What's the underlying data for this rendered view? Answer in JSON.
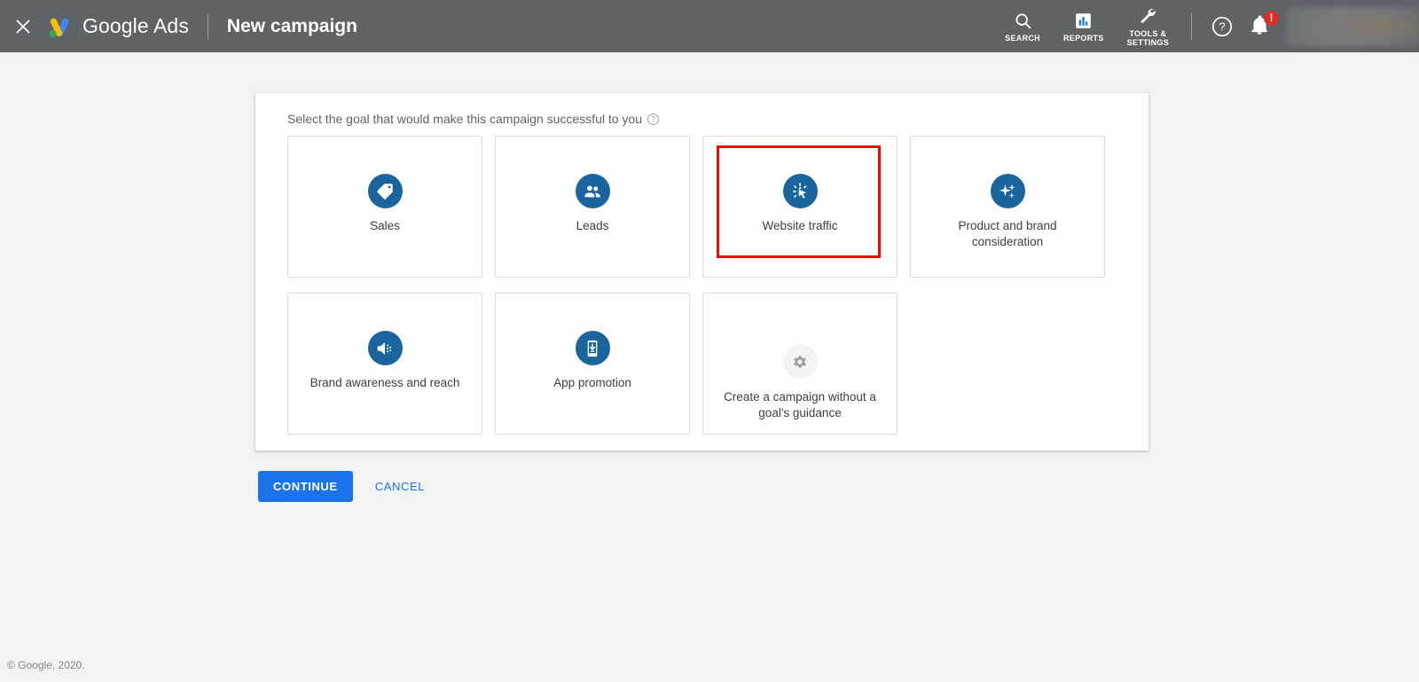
{
  "appbar": {
    "close_icon": "close-icon",
    "logo_icon": "google-ads-logo-icon",
    "brand": "Google Ads",
    "page_title": "New campaign",
    "colors": {
      "bar_background": "#5f6368",
      "logo_blue": "#4285f4",
      "logo_yellow": "#fbbc04",
      "logo_green": "#34a853"
    },
    "items": [
      {
        "id": "search",
        "icon": "search-icon",
        "label": "SEARCH"
      },
      {
        "id": "reports",
        "icon": "reports-bar-chart-icon",
        "label": "REPORTS"
      },
      {
        "id": "tools",
        "icon": "wrench-icon",
        "label": "TOOLS &\nSETTINGS"
      }
    ],
    "help": {
      "icon": "help-question-icon",
      "label": "?"
    },
    "notifications": {
      "icon": "bell-icon",
      "badge": "!",
      "badge_color": "#d93025"
    },
    "account": {
      "icon": "account-avatar-blurred"
    }
  },
  "main": {
    "heading": "Select the goal that would make this campaign successful to you",
    "heading_help_icon": "help-question-icon",
    "goals": [
      {
        "id": "sales",
        "label": "Sales",
        "icon": "price-tag-icon",
        "selected": false,
        "muted": false
      },
      {
        "id": "leads",
        "label": "Leads",
        "icon": "people-group-icon",
        "selected": false,
        "muted": false
      },
      {
        "id": "website-traffic",
        "label": "Website traffic",
        "icon": "cursor-click-icon",
        "selected": true,
        "muted": false
      },
      {
        "id": "product-brand-consideration",
        "label": "Product and brand consideration",
        "icon": "sparkle-stars-icon",
        "selected": false,
        "muted": false
      },
      {
        "id": "brand-awareness-reach",
        "label": "Brand awareness and reach",
        "icon": "speaker-volume-icon",
        "selected": false,
        "muted": false
      },
      {
        "id": "app-promotion",
        "label": "App promotion",
        "icon": "mobile-download-icon",
        "selected": false,
        "muted": false
      },
      {
        "id": "no-goal-guidance",
        "label": "Create a campaign without a goal's guidance",
        "icon": "gear-icon",
        "selected": false,
        "muted": true
      }
    ],
    "selection_highlight_color": "#ff0000",
    "goal_icon_color": "#1a659e"
  },
  "actions": {
    "continue_label": "CONTINUE",
    "cancel_label": "CANCEL",
    "continue_color": "#1a73e8"
  },
  "footer": {
    "copyright": "© Google, 2020."
  }
}
